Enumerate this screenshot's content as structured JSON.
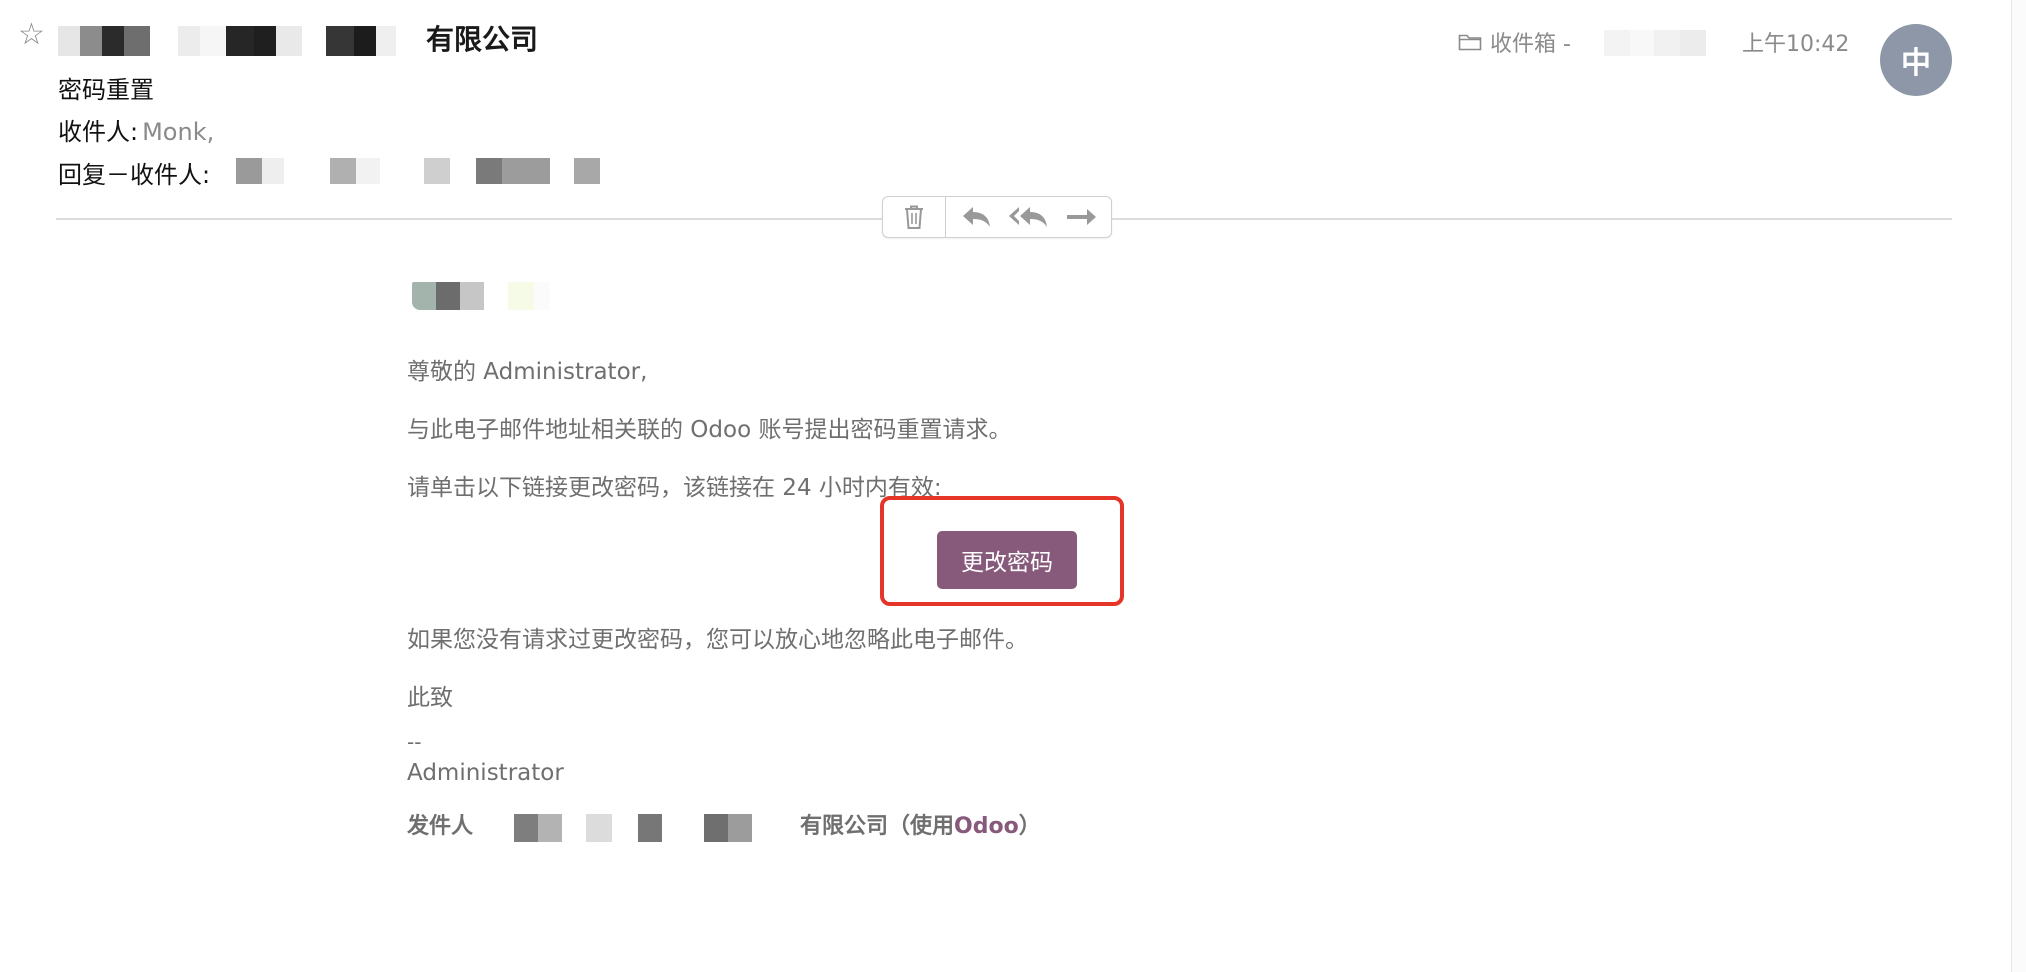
{
  "header": {
    "sender_suffix": "有限公司",
    "subject": "密码重置",
    "to_label": "收件人:",
    "to_value": "Monk,",
    "reply_to_label": "回复－收件人:",
    "folder_label": "收件箱 -",
    "time": "上午10:42",
    "avatar_initial": "中"
  },
  "body": {
    "greeting": "尊敬的 Administrator,",
    "line1": "与此电子邮件地址相关联的 Odoo 账号提出密码重置请求。",
    "line2": "请单击以下链接更改密码，该链接在 24 小时内有效:",
    "button_label": "更改密码",
    "ignore_note": "如果您没有请求过更改密码，您可以放心地忽略此电子邮件。",
    "regards": "此致",
    "signature_dashes": "--",
    "signature_name": "Administrator",
    "footer_prefix": "发件人",
    "footer_suffix": "有限公司（使用",
    "footer_brand": "Odoo",
    "footer_close": "）"
  },
  "icons": {
    "star": "star-icon",
    "folder": "folder-icon",
    "delete": "trash-icon",
    "reply": "reply-icon",
    "reply_all": "reply-all-icon",
    "forward": "forward-icon"
  },
  "colors": {
    "button": "#875a7b",
    "highlight_border": "#e53528",
    "avatar": "#8d97a8",
    "muted_text": "#6f6f6f"
  }
}
